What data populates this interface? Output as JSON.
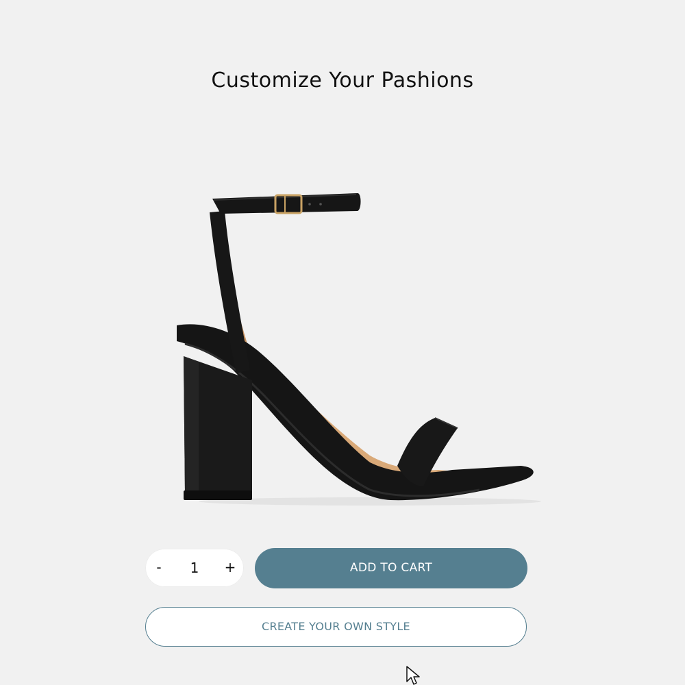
{
  "header": {
    "title": "Customize Your Pashions"
  },
  "product": {
    "image_icon": "sandal-image"
  },
  "quantity": {
    "decrement_label": "-",
    "value": "1",
    "increment_label": "+"
  },
  "actions": {
    "add_to_cart_label": "ADD TO CART",
    "create_style_label": "CREATE YOUR OWN STYLE"
  },
  "colors": {
    "background": "#f1f1f1",
    "accent": "#557f90",
    "text": "#111111"
  },
  "cursor_icon": "mouse-pointer-icon"
}
